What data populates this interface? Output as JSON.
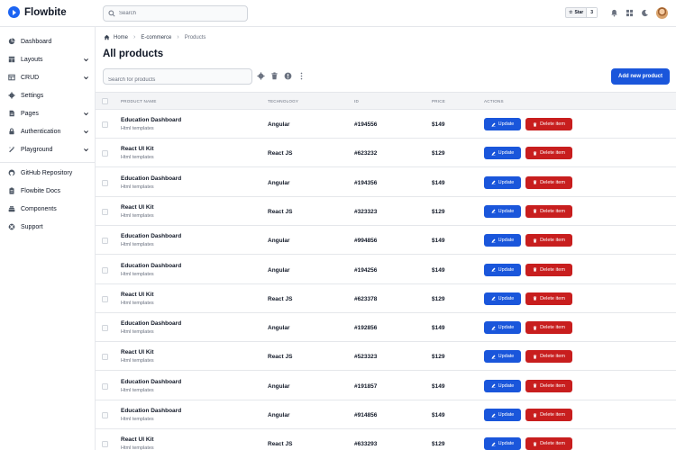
{
  "brand": {
    "name": "Flowbite"
  },
  "topbar": {
    "search_placeholder": "Search",
    "star_label": "Star",
    "star_count": "3",
    "icons": [
      "bell-icon",
      "apps-grid-icon",
      "moon-icon",
      "avatar"
    ]
  },
  "sidebar": {
    "items": [
      {
        "label": "Dashboard",
        "icon": "pie-chart-icon",
        "expandable": false
      },
      {
        "label": "Layouts",
        "icon": "layout-icon",
        "expandable": true
      },
      {
        "label": "CRUD",
        "icon": "table-icon",
        "expandable": true
      },
      {
        "label": "Settings",
        "icon": "gear-icon",
        "expandable": false
      },
      {
        "label": "Pages",
        "icon": "document-icon",
        "expandable": true
      },
      {
        "label": "Authentication",
        "icon": "lock-icon",
        "expandable": true
      },
      {
        "label": "Playground",
        "icon": "wand-icon",
        "expandable": true
      }
    ],
    "footer_items": [
      {
        "label": "GitHub Repository",
        "icon": "github-icon"
      },
      {
        "label": "Flowbite Docs",
        "icon": "clipboard-icon"
      },
      {
        "label": "Components",
        "icon": "stack-icon"
      },
      {
        "label": "Support",
        "icon": "lifebuoy-icon"
      }
    ]
  },
  "breadcrumb": {
    "home": "Home",
    "section": "E-commerce",
    "current": "Products"
  },
  "page": {
    "title": "All products",
    "search_placeholder": "Search for products",
    "add_button": "Add new product"
  },
  "table": {
    "columns": [
      "Product Name",
      "Technology",
      "ID",
      "Price",
      "Actions"
    ],
    "update_label": "Update",
    "delete_label": "Delete item",
    "rows": [
      {
        "name": "Education Dashboard",
        "category": "Html templates",
        "tech": "Angular",
        "id": "#194556",
        "price": "$149"
      },
      {
        "name": "React UI Kit",
        "category": "Html templates",
        "tech": "React JS",
        "id": "#623232",
        "price": "$129"
      },
      {
        "name": "Education Dashboard",
        "category": "Html templates",
        "tech": "Angular",
        "id": "#194356",
        "price": "$149"
      },
      {
        "name": "React UI Kit",
        "category": "Html templates",
        "tech": "React JS",
        "id": "#323323",
        "price": "$129"
      },
      {
        "name": "Education Dashboard",
        "category": "Html templates",
        "tech": "Angular",
        "id": "#994856",
        "price": "$149"
      },
      {
        "name": "Education Dashboard",
        "category": "Html templates",
        "tech": "Angular",
        "id": "#194256",
        "price": "$149"
      },
      {
        "name": "React UI Kit",
        "category": "Html templates",
        "tech": "React JS",
        "id": "#623378",
        "price": "$129"
      },
      {
        "name": "Education Dashboard",
        "category": "Html templates",
        "tech": "Angular",
        "id": "#192856",
        "price": "$149"
      },
      {
        "name": "React UI Kit",
        "category": "Html templates",
        "tech": "React JS",
        "id": "#523323",
        "price": "$129"
      },
      {
        "name": "Education Dashboard",
        "category": "Html templates",
        "tech": "Angular",
        "id": "#191857",
        "price": "$149"
      },
      {
        "name": "Education Dashboard",
        "category": "Html templates",
        "tech": "Angular",
        "id": "#914856",
        "price": "$149"
      },
      {
        "name": "React UI Kit",
        "category": "Html templates",
        "tech": "React JS",
        "id": "#633293",
        "price": "$129"
      }
    ]
  },
  "colors": {
    "primary": "#1a56db",
    "danger": "#c81e1e",
    "header_bg": "#f3f4f6"
  }
}
